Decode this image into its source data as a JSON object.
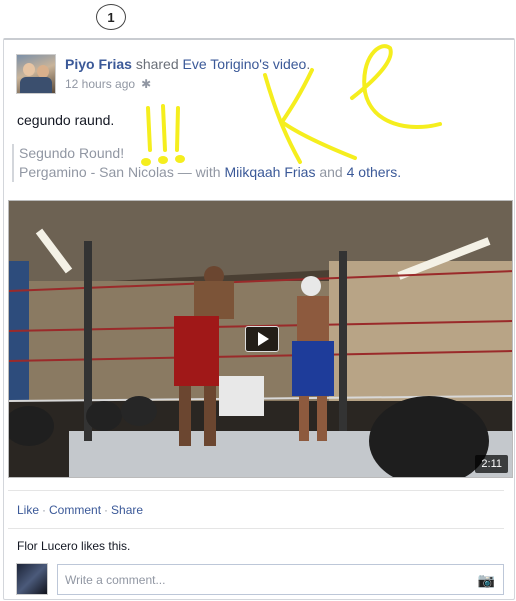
{
  "notification": {
    "count": "1"
  },
  "post": {
    "author": "Piyo Frias",
    "verb": "shared",
    "shared_from": "Eve Torigino's",
    "shared_object": "video",
    "time": "12 hours ago",
    "privacy_icon": "gear-icon",
    "status": "cegundo raund.",
    "quote_title": "Segundo Round!",
    "quote_location": "Pergamino - San Nicolas",
    "quote_with": "— with",
    "quote_tagged": "Miikqaah Frias",
    "quote_and": "and",
    "quote_others": "4 others."
  },
  "video": {
    "duration": "2:11",
    "play_icon": "play-icon"
  },
  "actions": {
    "like": "Like",
    "comment": "Comment",
    "share": "Share",
    "sep": "·"
  },
  "likes_text": "Flor Lucero likes this.",
  "comment": {
    "placeholder": "Write a comment...",
    "camera_icon": "camera-icon"
  },
  "annotation": {
    "color": "#f5ee1e"
  }
}
